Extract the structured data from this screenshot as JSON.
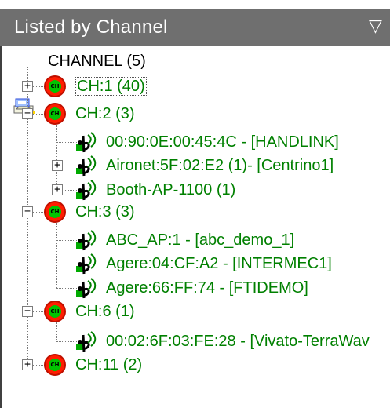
{
  "panel": {
    "title": "Listed by Channel",
    "menu_arrow": "▽"
  },
  "tree": {
    "root": {
      "label": "CHANNEL (5)",
      "icon": "network-computer-icon"
    },
    "channels": [
      {
        "label": "CH:1 (40)",
        "expanded": false,
        "selected": true,
        "children": []
      },
      {
        "label": "CH:2 (3)",
        "expanded": true,
        "children": [
          {
            "label": "00:90:0E:00:45:4C - [HANDLINK]",
            "expandable": false
          },
          {
            "label": "Aironet:5F:02:E2 (1)- [Centrino1]",
            "expandable": true
          },
          {
            "label": "Booth-AP-1100 (1)",
            "expandable": true
          }
        ]
      },
      {
        "label": "CH:3 (3)",
        "expanded": true,
        "children": [
          {
            "label": "ABC_AP:1 - [abc_demo_1]",
            "expandable": false
          },
          {
            "label": "Agere:04:CF:A2 - [INTERMEC1]",
            "expandable": false
          },
          {
            "label": "Agere:66:FF:74 - [FTIDEMO]",
            "expandable": false
          }
        ]
      },
      {
        "label": "CH:6 (1)",
        "expanded": true,
        "children": [
          {
            "label": "00:02:6F:03:FE:28 - [Vivato-TerraWav",
            "expandable": false
          }
        ]
      },
      {
        "label": "CH:11 (2)",
        "expanded": false,
        "children": []
      }
    ]
  },
  "icons": {
    "channel": "channel-icon",
    "access_point": "access-point-icon",
    "expand": "plus-box-icon",
    "collapse": "minus-box-icon"
  },
  "colors": {
    "title_background": "#6f6f6f",
    "tree_text": "#008000",
    "root_text": "#000000",
    "channel_red": "#ff1d00",
    "channel_green": "#00c400"
  }
}
